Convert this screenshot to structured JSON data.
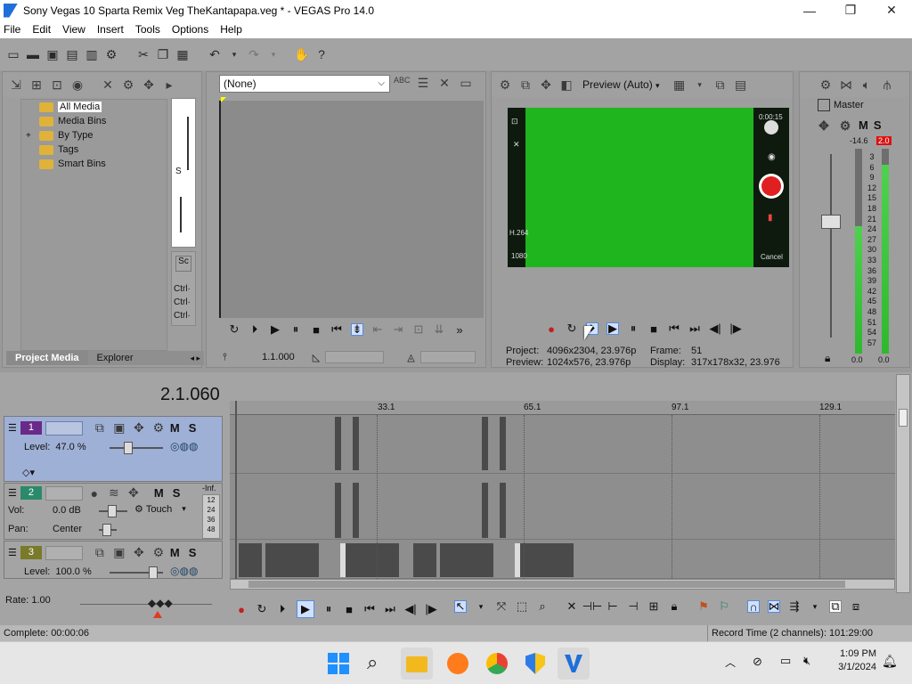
{
  "window": {
    "title": "Sony Vegas 10 Sparta Remix Veg TheKantapapa.veg * - VEGAS Pro 14.0",
    "min": "—",
    "max": "❐",
    "close": "✕"
  },
  "menu": [
    "File",
    "Edit",
    "View",
    "Insert",
    "Tools",
    "Options",
    "Help"
  ],
  "project_media": {
    "tree": [
      {
        "label": "All Media",
        "selected": true,
        "expander": ""
      },
      {
        "label": "Media Bins",
        "selected": false,
        "expander": ""
      },
      {
        "label": "By Type",
        "selected": false,
        "expander": "+"
      },
      {
        "label": "Tags",
        "selected": false,
        "expander": ""
      },
      {
        "label": "Smart Bins",
        "selected": false,
        "expander": ""
      }
    ],
    "tabs": [
      "Project Media",
      "Explorer"
    ],
    "side_labels": [
      "S",
      "Ctrl·",
      "Ctrl·",
      "Ctrl·"
    ]
  },
  "trimmer": {
    "select_value": "(None)",
    "position": "1.1.000"
  },
  "preview": {
    "mode": "Preview (Auto)",
    "project_label": "Project:",
    "project_value": "4096x2304, 23.976p",
    "preview_label": "Preview:",
    "preview_value": "1024x576, 23.976p",
    "frame_label": "Frame:",
    "frame_value": "51",
    "display_label": "Display:",
    "display_value": "317x178x32, 23.976",
    "overlay": {
      "top_right": "0:00:15",
      "left_mid": "H.264",
      "left_bottom": "1080",
      "cancel": "Cancel"
    }
  },
  "master": {
    "label": "Master",
    "m": "M",
    "s": "S",
    "peak_left": "-14.6",
    "peak_right": "2.0",
    "scale": [
      "3",
      "6",
      "9",
      "12",
      "15",
      "18",
      "21",
      "24",
      "27",
      "30",
      "33",
      "36",
      "39",
      "42",
      "45",
      "48",
      "51",
      "54",
      "57"
    ],
    "bottom_left": "0.0",
    "bottom_right": "0.0",
    "level_left": 0.62,
    "level_right": 0.92
  },
  "timeline": {
    "cursor_time": "2.1.060",
    "ruler_marks": [
      "33.1",
      "65.1",
      "97.1",
      "129.1"
    ],
    "tracks": [
      {
        "num": "1",
        "kind": "video",
        "level_label": "Level:",
        "level_value": "47.0 %",
        "m": "M",
        "s": "S"
      },
      {
        "num": "2",
        "kind": "audio",
        "vol_label": "Vol:",
        "vol_value": "0.0 dB",
        "pan_label": "Pan:",
        "pan_value": "Center",
        "mode": "Touch",
        "m": "M",
        "s": "S",
        "inf": "-Inf.",
        "meter_scale": [
          "12",
          "24",
          "36",
          "48"
        ]
      },
      {
        "num": "3",
        "kind": "video",
        "level_label": "Level:",
        "level_value": "100.0 %",
        "m": "M",
        "s": "S"
      }
    ]
  },
  "rate": {
    "label": "Rate: 1.00"
  },
  "status": {
    "left": "Complete: 00:00:06",
    "right": "Record Time (2 channels): 101:29:00"
  },
  "clock": {
    "time": "1:09 PM",
    "date": "3/1/2024"
  },
  "colors": {
    "track_video": "#6a2a8a",
    "track_audio": "#2a8a6a",
    "track3": "#7a7a2a",
    "green_screen": "#1fb51f",
    "record_red": "#e02020"
  }
}
